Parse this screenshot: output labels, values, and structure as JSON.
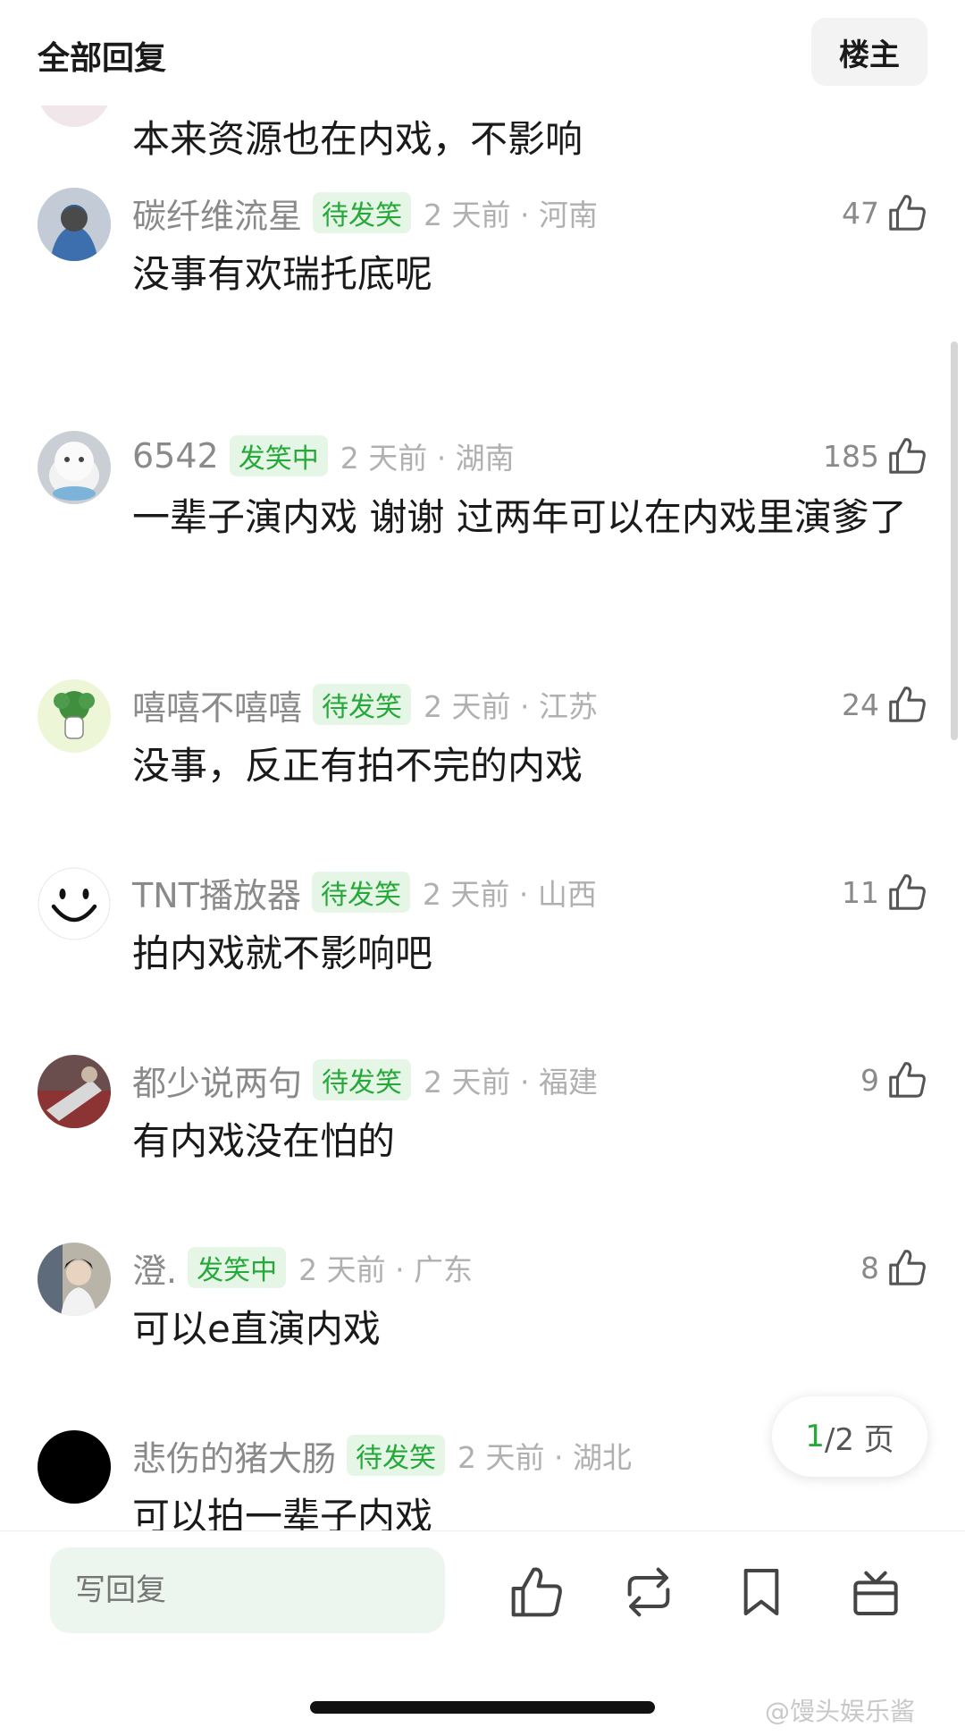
{
  "header": {
    "title": "全部回复",
    "op_button": "楼主"
  },
  "partial_comment": {
    "text": "本来资源也在内戏，不影响"
  },
  "comments": [
    {
      "username": "碳纤维流星",
      "badge": "待发笑",
      "time_loc": "2 天前 · 河南",
      "likes": "47",
      "text": "没事有欢瑞托底呢"
    },
    {
      "username": "6542",
      "badge": "发笑中",
      "time_loc": "2 天前 · 湖南",
      "likes": "185",
      "text": "一辈子演内戏 谢谢 过两年可以在内戏里演爹了"
    },
    {
      "username": "嘻嘻不嘻嘻",
      "badge": "待发笑",
      "time_loc": "2 天前 · 江苏",
      "likes": "24",
      "text": "没事，反正有拍不完的内戏"
    },
    {
      "username": "TNT播放器",
      "badge": "待发笑",
      "time_loc": "2 天前 · 山西",
      "likes": "11",
      "text": "拍内戏就不影响吧"
    },
    {
      "username": "都少说两句",
      "badge": "待发笑",
      "time_loc": "2 天前 · 福建",
      "likes": "9",
      "text": "有内戏没在怕的"
    },
    {
      "username": "澄.",
      "badge": "发笑中",
      "time_loc": "2 天前 · 广东",
      "likes": "8",
      "text": "可以e直演内戏"
    },
    {
      "username": "悲伤的猪大肠",
      "badge": "待发笑",
      "time_loc": "2 天前 · 湖北",
      "likes": "",
      "text": "可以拍一辈子内戏"
    }
  ],
  "pagination": {
    "current": "1",
    "total": "/2 页"
  },
  "bottom_bar": {
    "reply_placeholder": "写回复"
  },
  "watermark": "@馒头娱乐酱",
  "colors": {
    "badge_text": "#27a83a",
    "badge_bg": "#e6f6e6",
    "reply_bg": "#edf5ef"
  }
}
